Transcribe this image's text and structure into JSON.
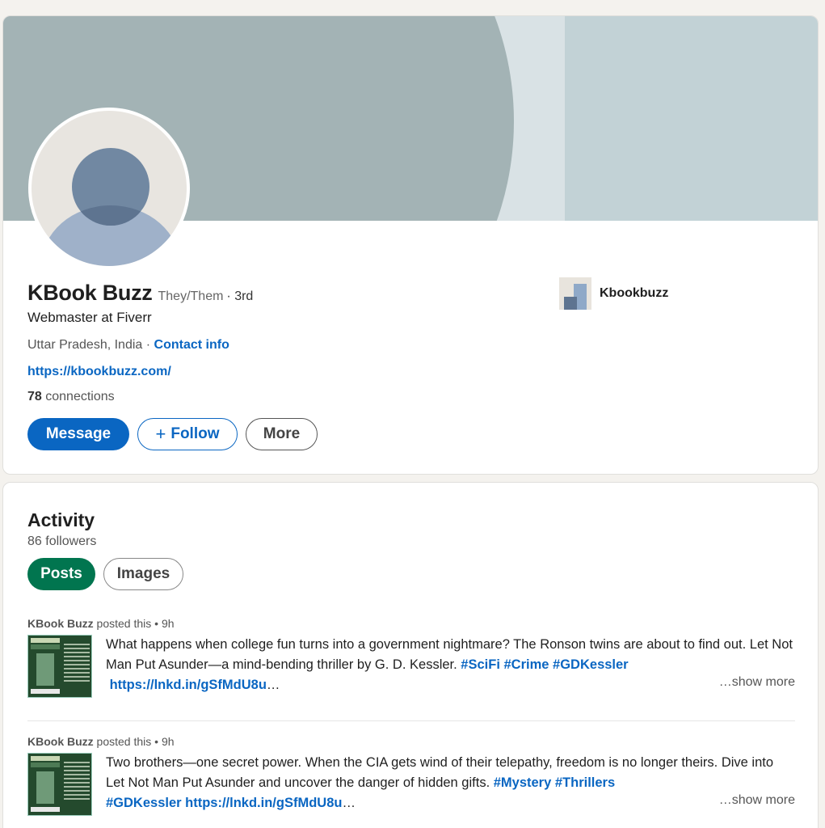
{
  "profile": {
    "name": "KBook Buzz",
    "pronouns": "They/Them",
    "degree": "· 3rd",
    "headline": "Webmaster at Fiverr",
    "location": "Uttar Pradesh, India · ",
    "contact_label": "Contact info",
    "website": "https://kbookbuzz.com/",
    "connections_count": "78",
    "connections_label": " connections",
    "company": "Kbookbuzz"
  },
  "actions": {
    "message": "Message",
    "follow_icon": "+",
    "follow": "Follow",
    "more": "More"
  },
  "activity": {
    "title": "Activity",
    "followers": "86 followers",
    "tabs": [
      "Posts",
      "Images"
    ],
    "posts": [
      {
        "author": "KBook Buzz",
        "meta": " posted this • 9h",
        "text": "What happens when college fun turns into a government nightmare? The Ronson twins are about to find out. Let Not Man Put Asunder—a mind-bending thriller by G. D. Kessler. ",
        "tags": [
          "#SciFi",
          "#Crime",
          "#GDKessler"
        ],
        "link": "https://lnkd.in/gSfMdU8u",
        "ellipsis": "…",
        "show_more": "…show more"
      },
      {
        "author": "KBook Buzz",
        "meta": " posted this • 9h",
        "text": "Two brothers—one secret power. When the CIA gets wind of their telepathy, freedom is no longer theirs. Dive into Let Not Man Put Asunder and uncover the danger of hidden gifts. ",
        "tags": [
          "#Mystery",
          "#Thrillers",
          "#GDKessler"
        ],
        "link": "https://lnkd.in/gSfMdU8u",
        "ellipsis": "…",
        "show_more": "…show more"
      }
    ]
  },
  "colors": {
    "accent": "#0a66c2",
    "posts_tab": "#01754f",
    "page_bg": "#f4f2ee"
  }
}
